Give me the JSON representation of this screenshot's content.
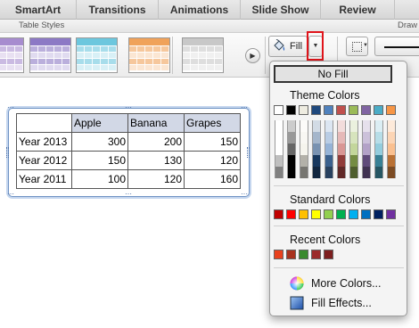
{
  "tabs": [
    "SmartArt",
    "Transitions",
    "Animations",
    "Slide Show",
    "Review"
  ],
  "groups": {
    "table_styles": "Table Styles",
    "draw": "Draw"
  },
  "style_thumb_colors": [
    "#a78ccf",
    "#8c79c5",
    "#6cc7de",
    "#f0a25a",
    "#c8c8c8"
  ],
  "fill": {
    "label": "Fill",
    "arrow": "▼"
  },
  "scroll_arrow": "▶",
  "table": {
    "headers": [
      "",
      "Apple",
      "Banana",
      "Grapes"
    ],
    "rows": [
      [
        "Year 2013",
        "300",
        "200",
        "150"
      ],
      [
        "Year 2012",
        "150",
        "130",
        "120"
      ],
      [
        "Year 2011",
        "100",
        "120",
        "160"
      ]
    ]
  },
  "menu": {
    "no_fill": "No Fill",
    "theme_colors_title": "Theme Colors",
    "theme_colors": [
      "#ffffff",
      "#000000",
      "#eeece1",
      "#1f497d",
      "#4f81bd",
      "#c0504d",
      "#9bbb59",
      "#8064a2",
      "#4bacc6",
      "#f79646"
    ],
    "standard_colors_title": "Standard Colors",
    "standard_colors": [
      "#c00000",
      "#ff0000",
      "#ffc000",
      "#ffff00",
      "#92d050",
      "#00b050",
      "#00b0f0",
      "#0070c0",
      "#002060",
      "#7030a0"
    ],
    "recent_colors_title": "Recent Colors",
    "recent_colors": [
      "#e8401c",
      "#a8331f",
      "#3a8a2e",
      "#9b2a2a",
      "#7d1f1f"
    ],
    "more_colors": "More Colors...",
    "fill_effects": "Fill Effects..."
  }
}
